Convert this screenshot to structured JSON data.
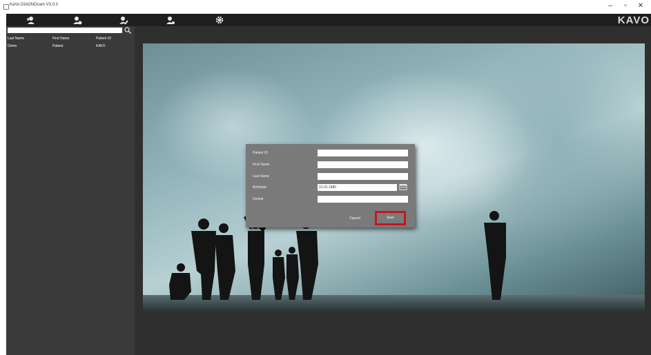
{
  "window": {
    "title": "KaVo DIAGNOcam V3.0.0",
    "controls": {
      "minimize": "–",
      "maximize": "▫",
      "close": "✕"
    }
  },
  "toolbar": {
    "icons": [
      "patients-icon",
      "add-patient-icon",
      "edit-patient-icon",
      "user-icon",
      "settings-gear-icon"
    ],
    "logo": "KAVO"
  },
  "sidebar": {
    "search_value": "",
    "columns": [
      "Last Name",
      "First Name",
      "Patient ID"
    ],
    "rows": [
      {
        "last_name": "Demo",
        "first_name": "Patient",
        "patient_id": "KAVO"
      }
    ]
  },
  "dialog": {
    "labels": {
      "patient_id": "Patient ID",
      "first_name": "First Name",
      "last_name": "Last Name",
      "birthdate": "Birthdate",
      "dentist": "Dentist"
    },
    "values": {
      "patient_id": "",
      "first_name": "",
      "last_name": "",
      "birthdate": "01.01.1980",
      "dentist": ""
    },
    "buttons": {
      "cancel": "Cancel",
      "save": "Save"
    }
  },
  "colors": {
    "highlight": "#c8151d",
    "app_bg": "#2f2f2f",
    "toolbar_bg": "#1f1f1f"
  }
}
